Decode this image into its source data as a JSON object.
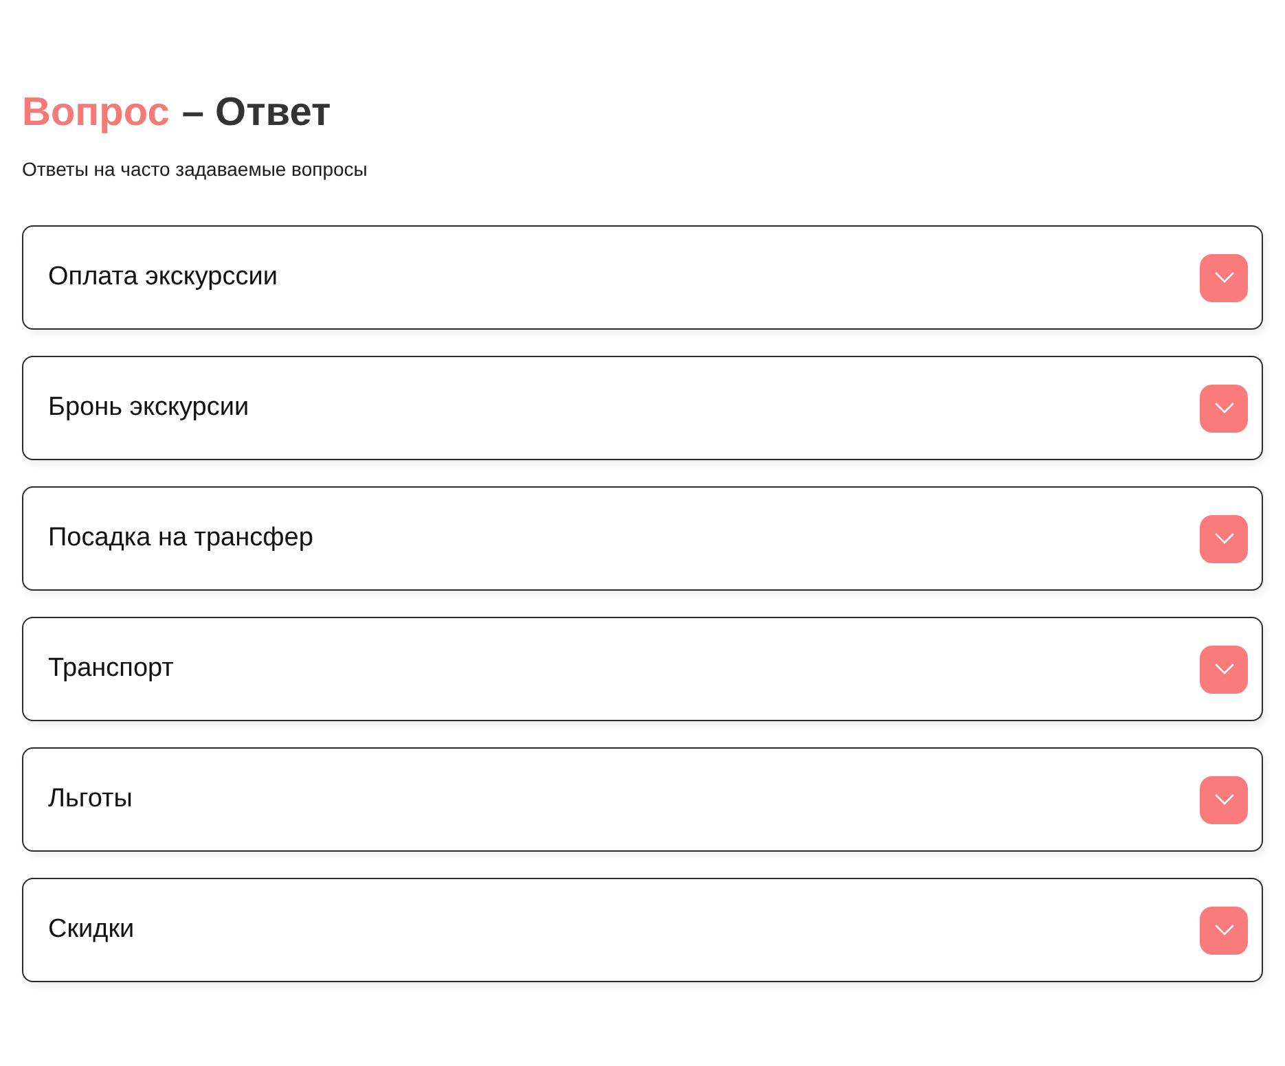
{
  "heading": {
    "accent": "Вопрос",
    "rest": "– Ответ"
  },
  "subtitle": "Ответы на часто задаваемые вопросы",
  "faq": [
    {
      "question": "Оплата экскурссии",
      "expanded": false
    },
    {
      "question": "Бронь экскурсии",
      "expanded": false
    },
    {
      "question": "Посадка на трансфер",
      "expanded": false
    },
    {
      "question": "Транспорт",
      "expanded": false
    },
    {
      "question": "Льготы",
      "expanded": false
    },
    {
      "question": "Скидки",
      "expanded": false
    }
  ]
}
